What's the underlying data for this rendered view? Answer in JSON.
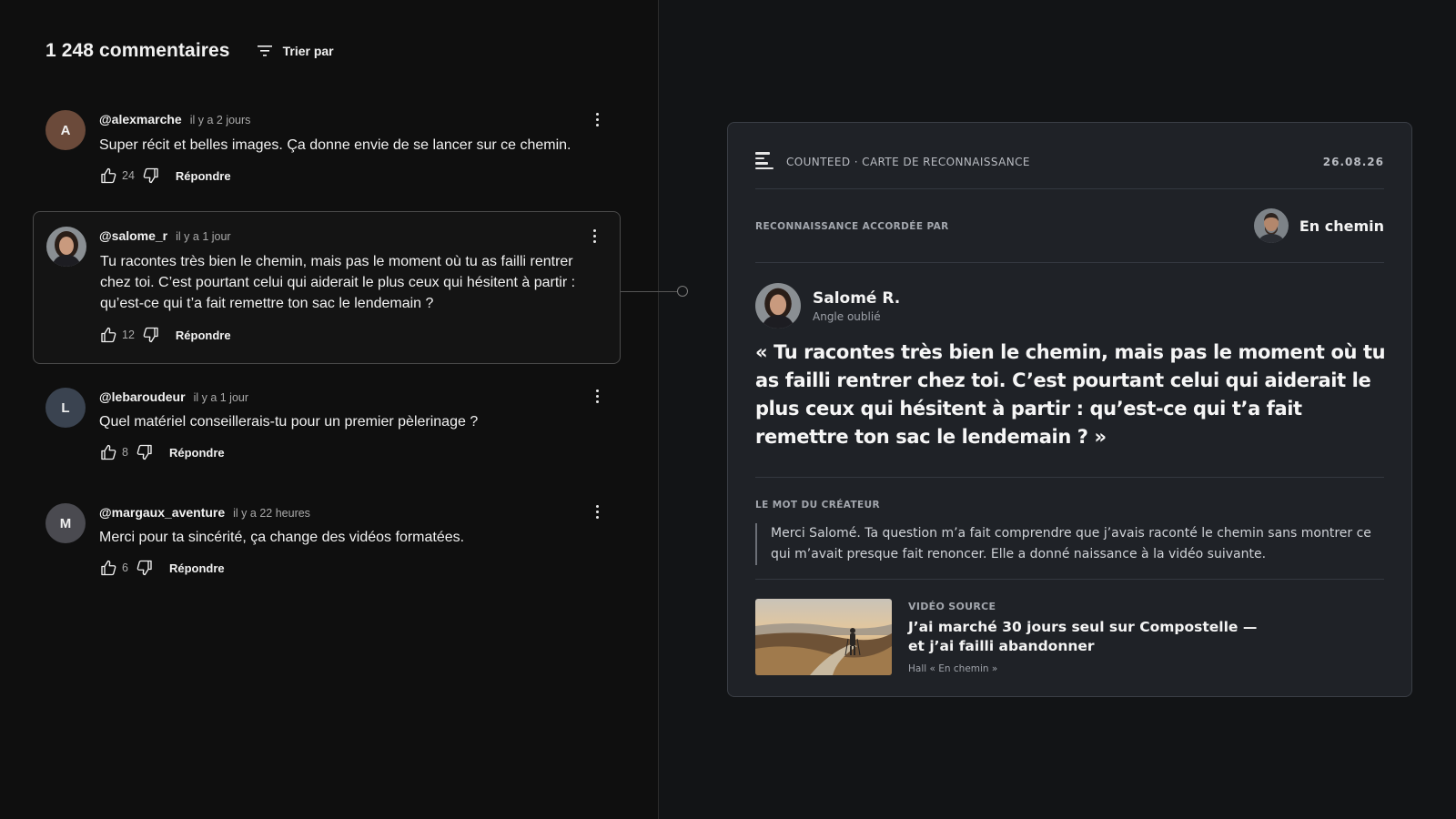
{
  "header": {
    "comments_count": "1 248 commentaires",
    "sort_label": "Trier par"
  },
  "comments": [
    {
      "initial": "A",
      "avatar_color": "#6b4a3a",
      "author": "@alexmarche",
      "time": "il y a 2 jours",
      "text": "Super récit et belles images. Ça donne envie de se lancer sur ce chemin.",
      "likes": "24",
      "reply": "Répondre"
    },
    {
      "initial": "",
      "avatar_icon": "portrait-photo",
      "author": "@salome_r",
      "time": "il y a 1 jour",
      "text": "Tu racontes très bien le chemin, mais pas le moment où tu as failli rentrer chez toi. C’est pourtant celui qui aiderait le plus ceux qui hésitent à partir : qu’est-ce qui t’a fait remettre ton sac le lendemain ?",
      "likes": "12",
      "reply": "Répondre"
    },
    {
      "initial": "L",
      "avatar_color": "#3a4350",
      "author": "@lebaroudeur",
      "time": "il y a 1 jour",
      "text": "Quel matériel conseillerais-tu pour un premier pèlerinage ?",
      "likes": "8",
      "reply": "Répondre"
    },
    {
      "initial": "M",
      "avatar_color": "#4a4a50",
      "author": "@margaux_aventure",
      "time": "il y a 22 heures",
      "text": "Merci pour ta sincérité, ça change des vidéos formatées.",
      "likes": "6",
      "reply": "Répondre"
    }
  ],
  "card": {
    "brand": "COUNTEED · CARTE DE RECONNAISSANCE",
    "date": "26.08.26",
    "granted_label": "RECONNAISSANCE ACCORDÉE PAR",
    "granter_name": "En chemin",
    "person_name": "Salomé R.",
    "person_role": "Angle oublié",
    "quote": "« Tu racontes très bien le chemin, mais pas le moment où tu as failli rentrer chez toi. C’est pourtant celui qui aiderait le plus ceux qui hésitent à partir : qu’est-ce qui t’a fait remettre ton sac le lendemain ? »",
    "creator_label": "LE MOT DU CRÉATEUR",
    "creator_word": "Merci Salomé. Ta question m’a fait comprendre que j’avais raconté le chemin sans montrer ce qui m’avait presque fait renoncer. Elle a donné naissance à la vidéo suivante.",
    "video_label": "VIDÉO SOURCE",
    "video_title": "J’ai marché 30 jours seul sur Compostelle — et j’ai failli abandonner",
    "video_hall": "Hall « En chemin »"
  },
  "colors": {
    "background": "#0f0f0f",
    "card_bg": "#1f2227",
    "highlight_border": "#4a4a4a"
  }
}
